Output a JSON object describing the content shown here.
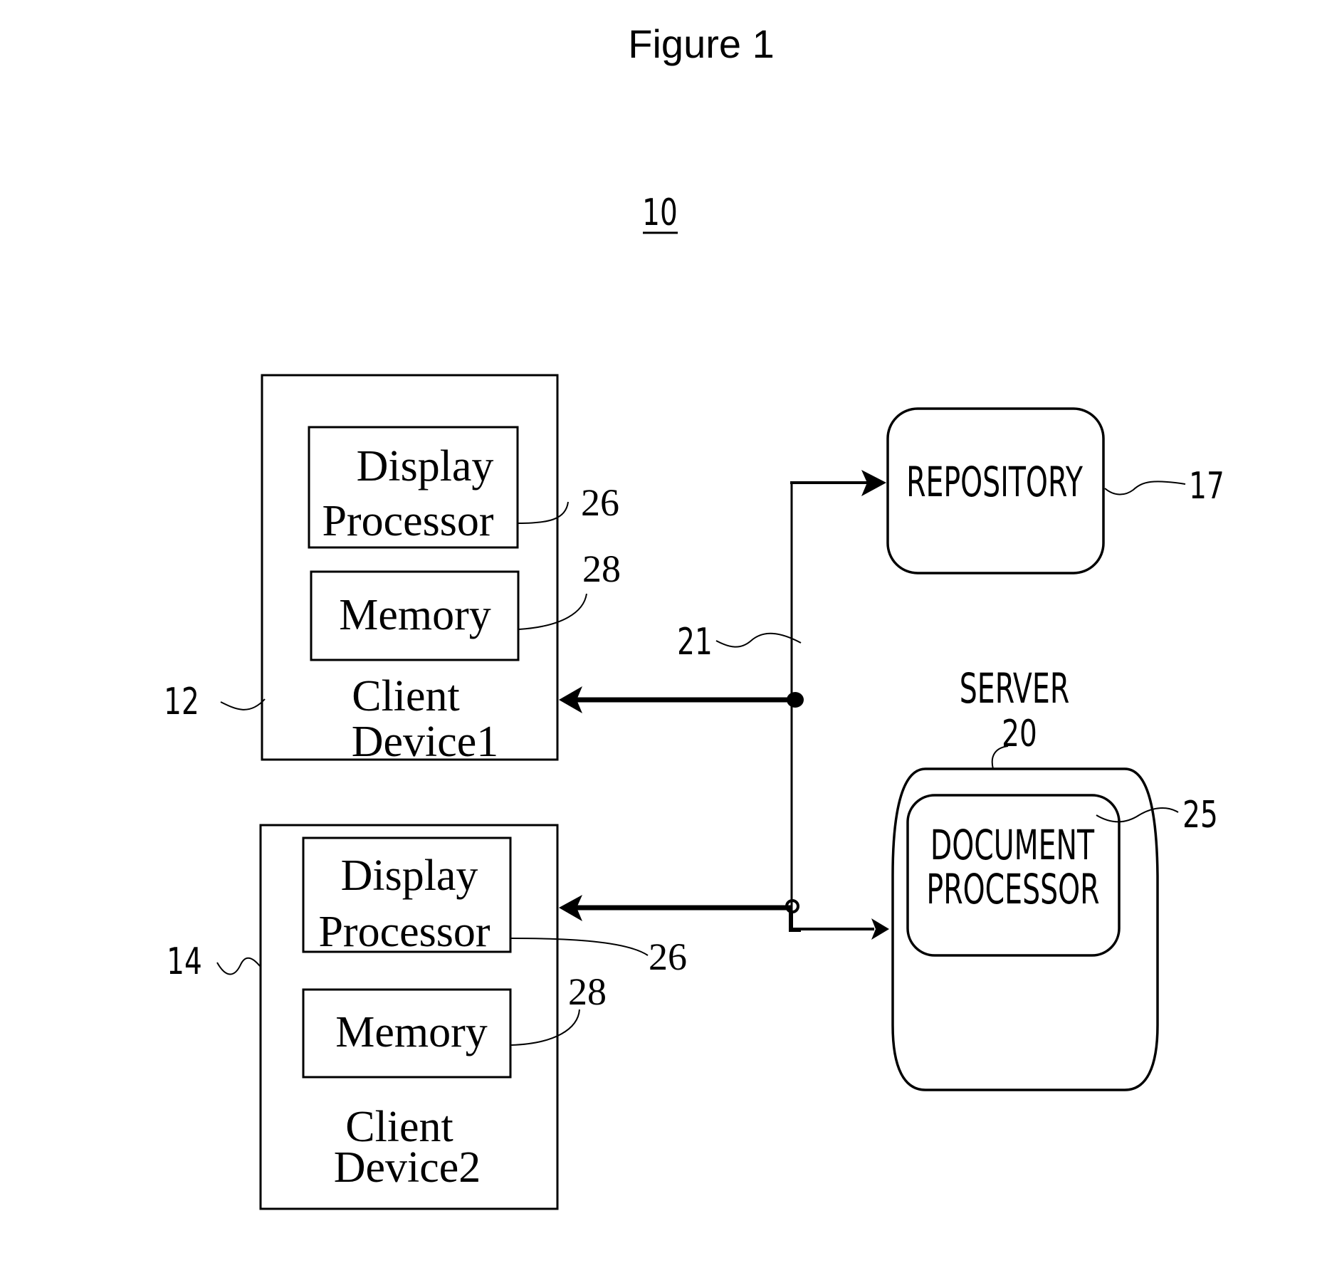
{
  "figure": {
    "title": "Figure 1",
    "system_ref": "10"
  },
  "client_device_1": {
    "ref": "12",
    "label_line1": "Client",
    "label_line2": "Device1",
    "display_processor": {
      "line1": "Display",
      "line2": "Processor",
      "ref": "26"
    },
    "memory": {
      "label": "Memory",
      "ref": "28"
    }
  },
  "client_device_2": {
    "ref": "14",
    "label_line1": "Client",
    "label_line2": "Device2",
    "display_processor": {
      "line1": "Display",
      "line2": "Processor",
      "ref": "26"
    },
    "memory": {
      "label": "Memory",
      "ref": "28"
    }
  },
  "network": {
    "ref": "21"
  },
  "repository": {
    "label": "REPOSITORY",
    "ref": "17"
  },
  "server": {
    "label": "SERVER",
    "ref": "20",
    "document_processor": {
      "line1": "DOCUMENT",
      "line2": "PROCESSOR",
      "ref": "25"
    }
  }
}
